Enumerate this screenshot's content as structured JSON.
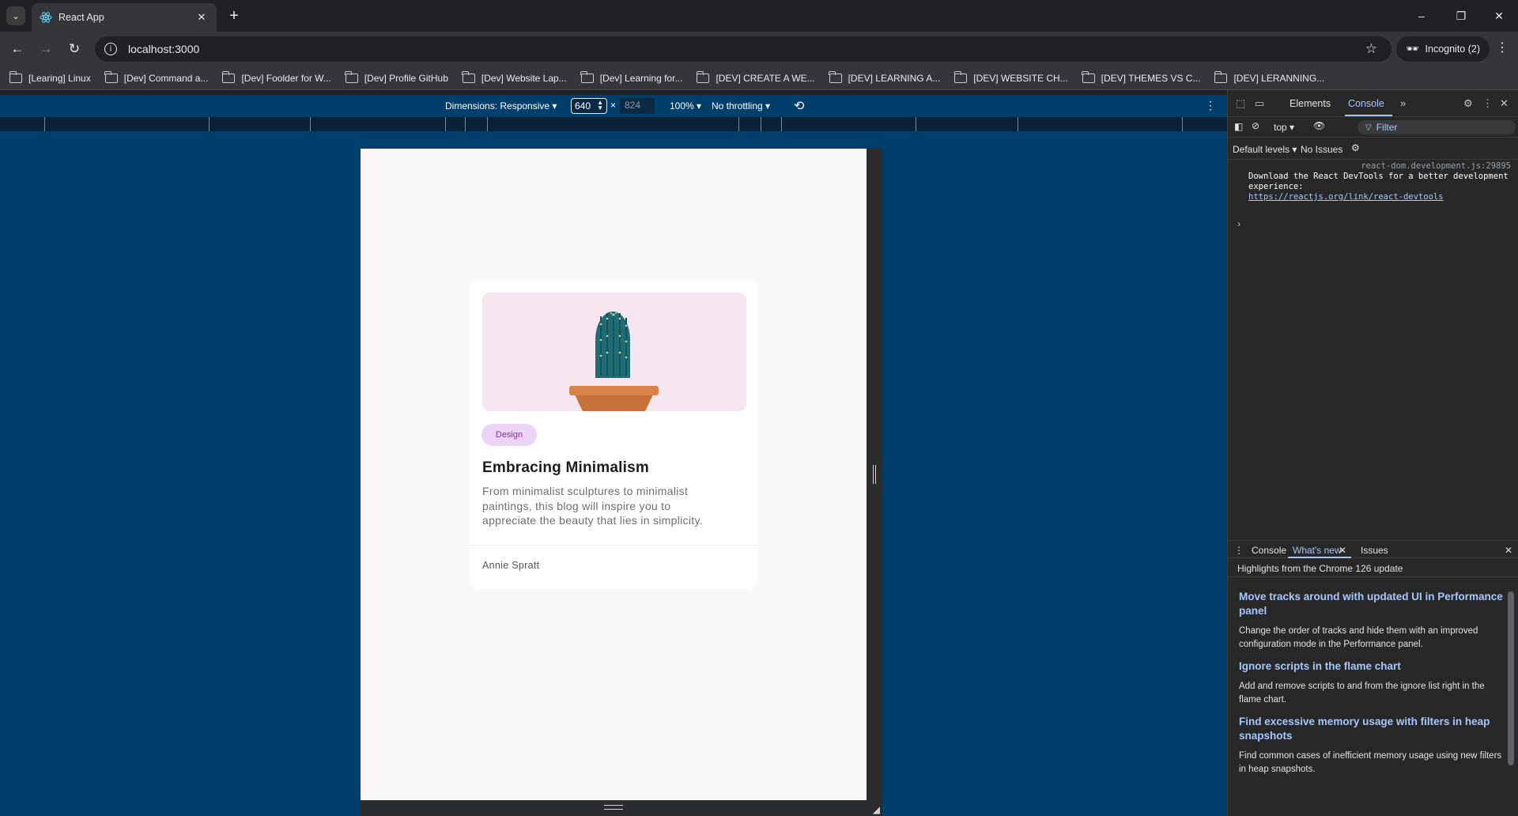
{
  "browser": {
    "tab_title": "React App",
    "url": "localhost:3000",
    "incognito_label": "Incognito (2)",
    "bookmarks": [
      "[Learing] Linux",
      "[Dev] Command a...",
      "[Dev] Foolder for W...",
      "[Dev] Profile GitHub",
      "[Dev] Website Lap...",
      "[Dev] Learning for...",
      "[DEV] CREATE A WE...",
      "[DEV] LEARNING A...",
      "[DEV] WEBSITE CH...",
      "[DEV] THEMES VS C...",
      "[DEV] LERANNING..."
    ]
  },
  "device_toolbar": {
    "dimensions_label": "Dimensions: Responsive",
    "width": "640",
    "times": "×",
    "height": "824",
    "zoom": "100%",
    "throttling": "No throttling"
  },
  "card": {
    "tag": "Design",
    "title": "Embracing Minimalism",
    "description": "From minimalist sculptures to minimalist paintings, this blog will inspire you to appreciate the beauty that lies in simplicity.",
    "author": "Annie Spratt"
  },
  "devtools": {
    "tabs": [
      "Elements",
      "Console"
    ],
    "active_tab": "Console",
    "context": "top",
    "filter_placeholder": "Filter",
    "levels": "Default levels",
    "issues": "No Issues",
    "message": {
      "source": "react-dom.development.js:29895",
      "text": "Download the React DevTools for a better development experience:",
      "link": "https://reactjs.org/link/react-devtools"
    },
    "drawer": {
      "tabs": [
        "Console",
        "What's new",
        "Issues"
      ],
      "active_tab": "What's new",
      "header": "Highlights from the Chrome 126 update",
      "items": [
        {
          "title": "Move tracks around with updated UI in Performance panel",
          "body": "Change the order of tracks and hide them with an improved configuration mode in the Performance panel."
        },
        {
          "title": "Ignore scripts in the flame chart",
          "body": "Add and remove scripts to and from the ignore list right in the flame chart."
        },
        {
          "title": "Find excessive memory usage with filters in heap snapshots",
          "body": "Find common cases of inefficient memory usage using new filters in heap snapshots."
        }
      ]
    }
  },
  "colors": {
    "viewport_bg": "#003e6b",
    "page_bg": "#f9f8f6",
    "tag_bg": "#ecd4f7",
    "tag_text": "#7b2fa7",
    "devtools_accent": "#a8c7fa"
  }
}
